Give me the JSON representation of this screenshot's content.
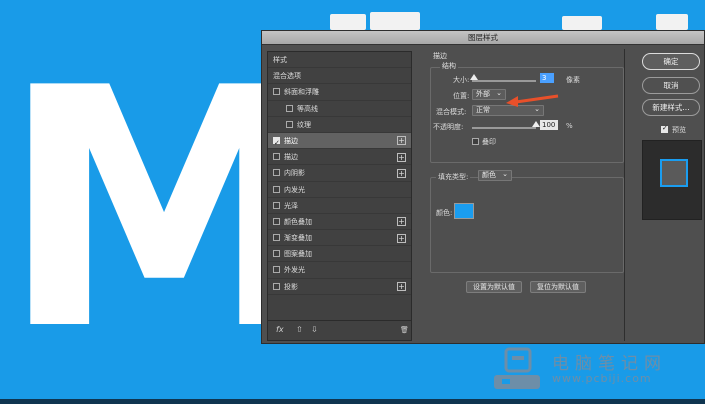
{
  "background": {
    "letter": "M",
    "color": "#199be8"
  },
  "dialog": {
    "title": "图层样式",
    "left_panel": {
      "items": [
        {
          "label": "样式",
          "checkbox": false,
          "checked": false,
          "plus": false,
          "active": false,
          "indent": 0
        },
        {
          "label": "混合选项",
          "checkbox": false,
          "checked": false,
          "plus": false,
          "active": false,
          "indent": 0
        },
        {
          "label": "斜面和浮雕",
          "checkbox": true,
          "checked": false,
          "plus": false,
          "active": false,
          "indent": 0
        },
        {
          "label": "等高线",
          "checkbox": true,
          "checked": false,
          "plus": false,
          "active": false,
          "indent": 1
        },
        {
          "label": "纹理",
          "checkbox": true,
          "checked": false,
          "plus": false,
          "active": false,
          "indent": 1
        },
        {
          "label": "描边",
          "checkbox": true,
          "checked": true,
          "plus": true,
          "active": true,
          "indent": 0
        },
        {
          "label": "描边",
          "checkbox": true,
          "checked": false,
          "plus": true,
          "active": false,
          "indent": 0
        },
        {
          "label": "内阴影",
          "checkbox": true,
          "checked": false,
          "plus": true,
          "active": false,
          "indent": 0
        },
        {
          "label": "内发光",
          "checkbox": true,
          "checked": false,
          "plus": false,
          "active": false,
          "indent": 0
        },
        {
          "label": "光泽",
          "checkbox": true,
          "checked": false,
          "plus": false,
          "active": false,
          "indent": 0
        },
        {
          "label": "颜色叠加",
          "checkbox": true,
          "checked": false,
          "plus": true,
          "active": false,
          "indent": 0
        },
        {
          "label": "渐变叠加",
          "checkbox": true,
          "checked": false,
          "plus": true,
          "active": false,
          "indent": 0
        },
        {
          "label": "图案叠加",
          "checkbox": true,
          "checked": false,
          "plus": false,
          "active": false,
          "indent": 0
        },
        {
          "label": "外发光",
          "checkbox": true,
          "checked": false,
          "plus": false,
          "active": false,
          "indent": 0
        },
        {
          "label": "投影",
          "checkbox": true,
          "checked": false,
          "plus": true,
          "active": false,
          "indent": 0
        }
      ],
      "footer": {
        "fx": "fx",
        "up": "⇧",
        "down": "⇩",
        "trash": "🗑"
      }
    },
    "stroke": {
      "section_title": "描边",
      "structure_title": "结构",
      "size_label": "大小:",
      "size_value": "3",
      "size_unit": "像素",
      "size_slider_fraction": 0.03,
      "position_label": "位置:",
      "position_value": "外部",
      "blend_label": "混合模式:",
      "blend_value": "正常",
      "opacity_label": "不透明度:",
      "opacity_value": "100",
      "opacity_unit": "%",
      "opacity_slider_fraction": 1.0,
      "overprint_label": "叠印",
      "fill_type_label": "填充类型:",
      "fill_type_value": "颜色",
      "color_label": "颜色:",
      "color_value": "#1a9df0",
      "set_default": "设置为默认值",
      "reset_default": "复位为默认值"
    },
    "buttons": {
      "ok": "确定",
      "cancel": "取消",
      "new_style": "新建样式...",
      "preview_label": "预览",
      "preview_checked": true
    },
    "accent_arrow_color": "#e8502a"
  },
  "watermark": {
    "title": "电脑笔记网",
    "url": "www.pcbiji.com"
  }
}
